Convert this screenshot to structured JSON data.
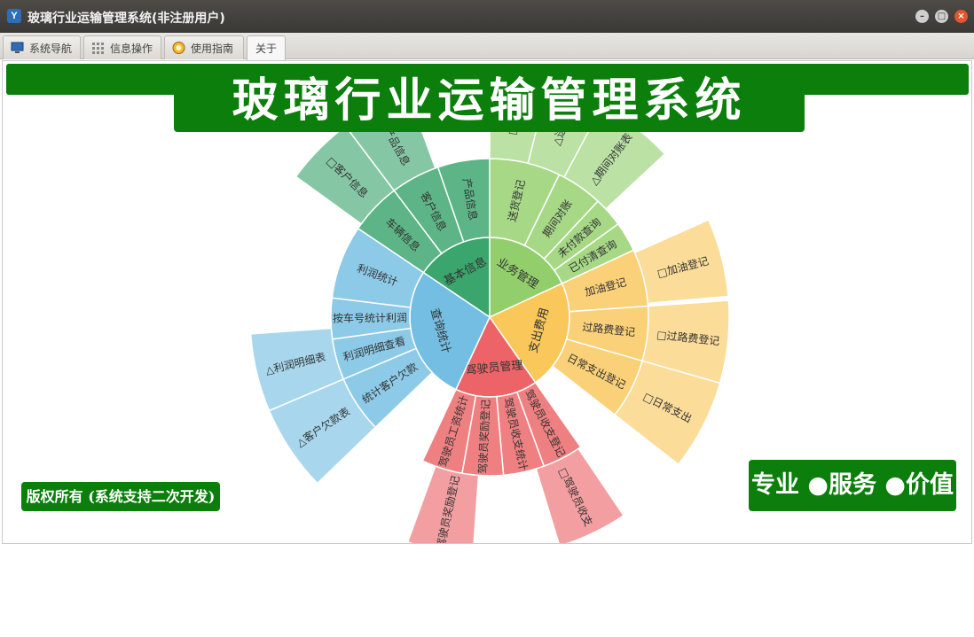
{
  "window": {
    "title": "玻璃行业运输管理系统(非注册用户)",
    "app_icon": "Y",
    "controls": {
      "minimize": "–",
      "maximize": "□",
      "close": "×"
    }
  },
  "tabs": [
    {
      "label": "系统导航",
      "icon": "monitor-icon"
    },
    {
      "label": "信息操作",
      "icon": "grid-icon"
    },
    {
      "label": "使用指南",
      "icon": "help-globe-icon"
    },
    {
      "label": "关于",
      "active": true
    }
  ],
  "banner": {
    "title": "玻璃行业运输管理系统"
  },
  "footer": {
    "copyright": "版权所有 (系统支持二次开发)",
    "slogan": "专业 ●服务 ●价值"
  },
  "colors": {
    "title_green": "#0b7e0b",
    "basic_info": "#3aa56d",
    "business": "#92cf6c",
    "expense": "#f9c75a",
    "driver": "#ec6467",
    "query": "#73bee2"
  },
  "sunburst": {
    "center_labels": [
      "基本信息",
      "业务管理",
      "支出费用",
      "驾驶员管理",
      "查询统计"
    ],
    "ring2_labels": [
      "车辆信息",
      "客户信息",
      "产品信息",
      "送货登记",
      "期间对账",
      "未付款查询",
      "已付清查询",
      "加油登记",
      "过路费登记",
      "日常支出登记",
      "驾驶员收支登记",
      "驾驶员收支统计",
      "驾驶员奖励登记",
      "驾驶员工资统计",
      "统计客户欠款",
      "利润明细查看",
      "按车号统计利润",
      "利润统计"
    ],
    "ring3_labels": [
      "□客户信息",
      "□产品信息",
      "□送货",
      "△送货",
      "△期间对账表",
      "□加油登记",
      "□过路费登记",
      "□日常支出",
      "□驾驶员收支",
      "驾驶员奖励登记",
      "△客户欠款表",
      "△利润明细表"
    ]
  }
}
